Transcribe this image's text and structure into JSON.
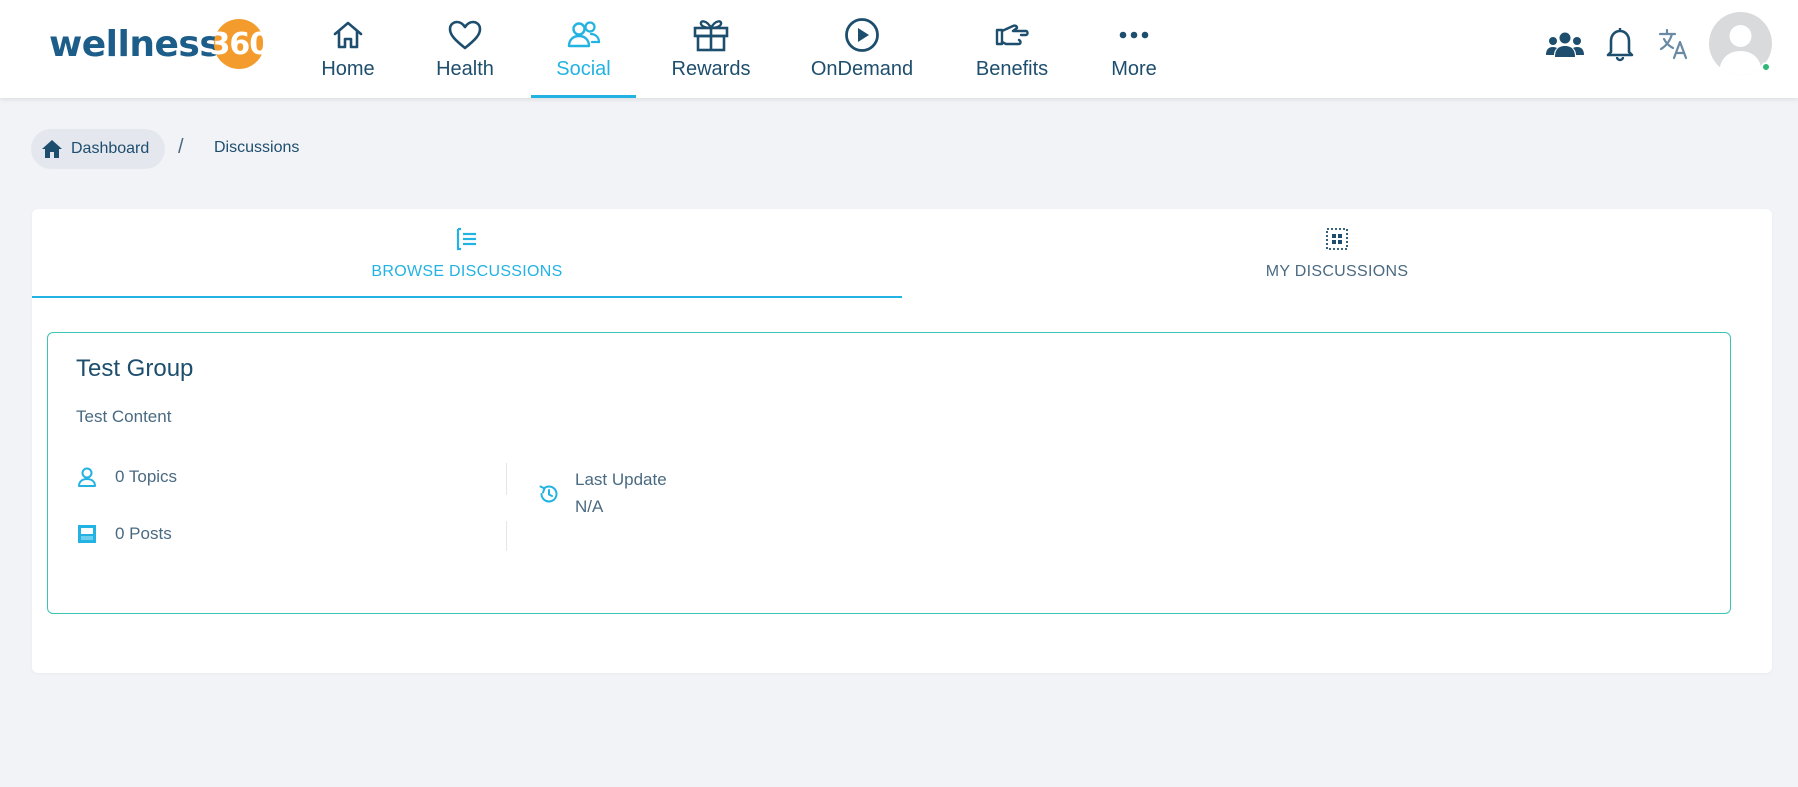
{
  "logo": {
    "text": "wellness",
    "badge": "360"
  },
  "nav": [
    {
      "label": "Home",
      "icon": "home-icon"
    },
    {
      "label": "Health",
      "icon": "heart-icon"
    },
    {
      "label": "Social",
      "icon": "people-icon",
      "active": true
    },
    {
      "label": "Rewards",
      "icon": "gift-icon"
    },
    {
      "label": "OnDemand",
      "icon": "play-circle-icon"
    },
    {
      "label": "Benefits",
      "icon": "hand-icon"
    },
    {
      "label": "More",
      "icon": "more-dots-icon"
    }
  ],
  "header_icons": [
    "group-icon",
    "bell-icon",
    "translate-icon",
    "avatar"
  ],
  "breadcrumb": {
    "home": "Dashboard",
    "separator": "/",
    "current": "Discussions"
  },
  "tabs": [
    {
      "label": "BROWSE DISCUSSIONS",
      "icon": "list-icon",
      "active": true
    },
    {
      "label": "MY DISCUSSIONS",
      "icon": "grid-icon",
      "active": false
    }
  ],
  "group": {
    "title": "Test Group",
    "content": "Test Content",
    "topics": "0 Topics",
    "posts": "0 Posts",
    "last_update_label": "Last Update",
    "last_update_value": "N/A"
  },
  "colors": {
    "accent": "#23b3e3",
    "primary_text": "#1e4e6e",
    "card_border": "#3cc5b4",
    "logo_orange": "#f39c2d",
    "status_online": "#2fb77a"
  }
}
